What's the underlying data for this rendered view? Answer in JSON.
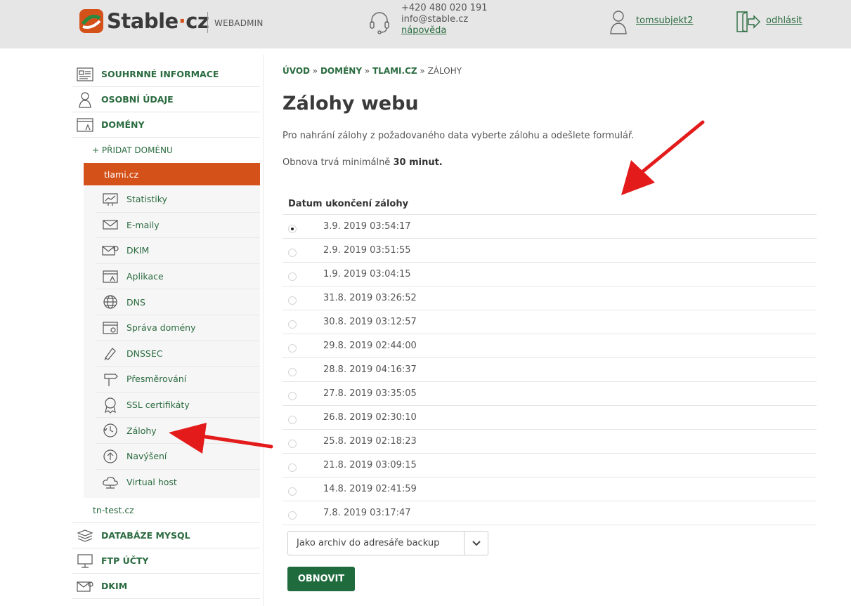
{
  "header": {
    "logo_text_main": "Stable",
    "logo_text_dot": "·",
    "logo_text_tld": "cz",
    "section": "WEBADMIN",
    "phone": "+420 480 020 191",
    "email": "info@stable.cz",
    "help": "nápověda",
    "username": "tomsubjekt2",
    "logout": "odhlásit"
  },
  "sidebar": {
    "summary": "SOUHRNNÉ INFORMACE",
    "personal": "OSOBNÍ ÚDAJE",
    "domains": "DOMÉNY",
    "add_domain": "+ PŘIDAT DOMÉNU",
    "active_domain": "tlami.cz",
    "sub_items": [
      {
        "label": "Statistiky",
        "icon": "statistics-icon"
      },
      {
        "label": "E-maily",
        "icon": "email-icon"
      },
      {
        "label": "DKIM",
        "icon": "dkim-icon"
      },
      {
        "label": "Aplikace",
        "icon": "apps-icon"
      },
      {
        "label": "DNS",
        "icon": "globe-icon"
      },
      {
        "label": "Správa domény",
        "icon": "domain-manage-icon"
      },
      {
        "label": "DNSSEC",
        "icon": "dnssec-icon"
      },
      {
        "label": "Přesměrování",
        "icon": "redirect-icon"
      },
      {
        "label": "SSL certifikáty",
        "icon": "ssl-icon"
      },
      {
        "label": "Zálohy",
        "icon": "backup-icon"
      },
      {
        "label": "Navýšení",
        "icon": "upgrade-icon"
      },
      {
        "label": "Virtual host",
        "icon": "cloud-icon"
      }
    ],
    "other_domain": "tn-test.cz",
    "databases": "DATABÁZE MYSQL",
    "ftp": "FTP ÚČTY",
    "dkim": "DKIM"
  },
  "breadcrumb": {
    "home": "ÚVOD",
    "sep1": " » ",
    "domains": "DOMÉNY",
    "sep2": " » ",
    "domain": "TLAMI.CZ",
    "sep3": " » ",
    "current": "ZÁLOHY"
  },
  "main": {
    "title": "Zálohy webu",
    "intro": "Pro nahrání zálohy z požadovaného data vyberte zálohu a odešlete formulář.",
    "note_prefix": "Obnova trvá minimálně ",
    "note_bold": "30 minut."
  },
  "table": {
    "header": "Datum ukončení zálohy",
    "selected_index": 0,
    "rows": [
      "3.9. 2019 03:54:17",
      "2.9. 2019 03:51:55",
      "1.9. 2019 03:04:15",
      "31.8. 2019 03:26:52",
      "30.8. 2019 03:12:57",
      "29.8. 2019 02:44:00",
      "28.8. 2019 04:16:37",
      "27.8. 2019 03:35:05",
      "26.8. 2019 02:30:10",
      "25.8. 2019 02:18:23",
      "21.8. 2019 03:09:15",
      "14.8. 2019 02:41:59",
      "7.8. 2019 03:17:47"
    ]
  },
  "restore": {
    "mode_selected": "Jako archiv do adresáře backup",
    "button": "OBNOVIT"
  },
  "colors": {
    "brand_green": "#2a6b3f",
    "active_orange": "#d4511a",
    "button_green": "#1f6b3d",
    "annotation_red": "#e31b1b"
  }
}
